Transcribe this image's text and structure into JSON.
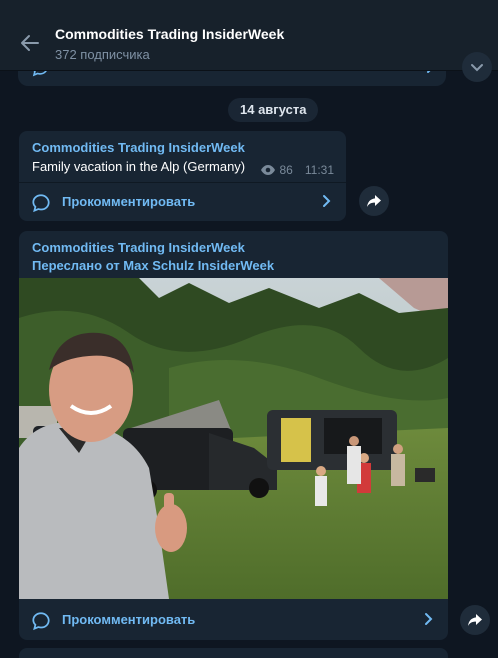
{
  "header": {
    "title": "Commodities Trading InsiderWeek",
    "subscribers": "372 подписчика"
  },
  "date_separator": "14 августа",
  "messages": [
    {
      "author": "Commodities Trading InsiderWeek",
      "text": "Family vacation in the Alp (Germany)",
      "views": "86",
      "time": "11:31",
      "comment_label": "Прокомментировать"
    },
    {
      "author": "Commodities Trading InsiderWeek",
      "forwarded_from": "Переслано от Max Schulz InsiderWeek",
      "comment_label": "Прокомментировать"
    }
  ],
  "colors": {
    "background": "#0e1621",
    "header": "#17212b",
    "bubble": "#182533",
    "accent": "#71baf3",
    "muted": "#7a8a9a"
  },
  "icons": [
    "back-arrow-icon",
    "eye-icon",
    "comment-icon",
    "chevron-right-icon",
    "share-icon"
  ]
}
